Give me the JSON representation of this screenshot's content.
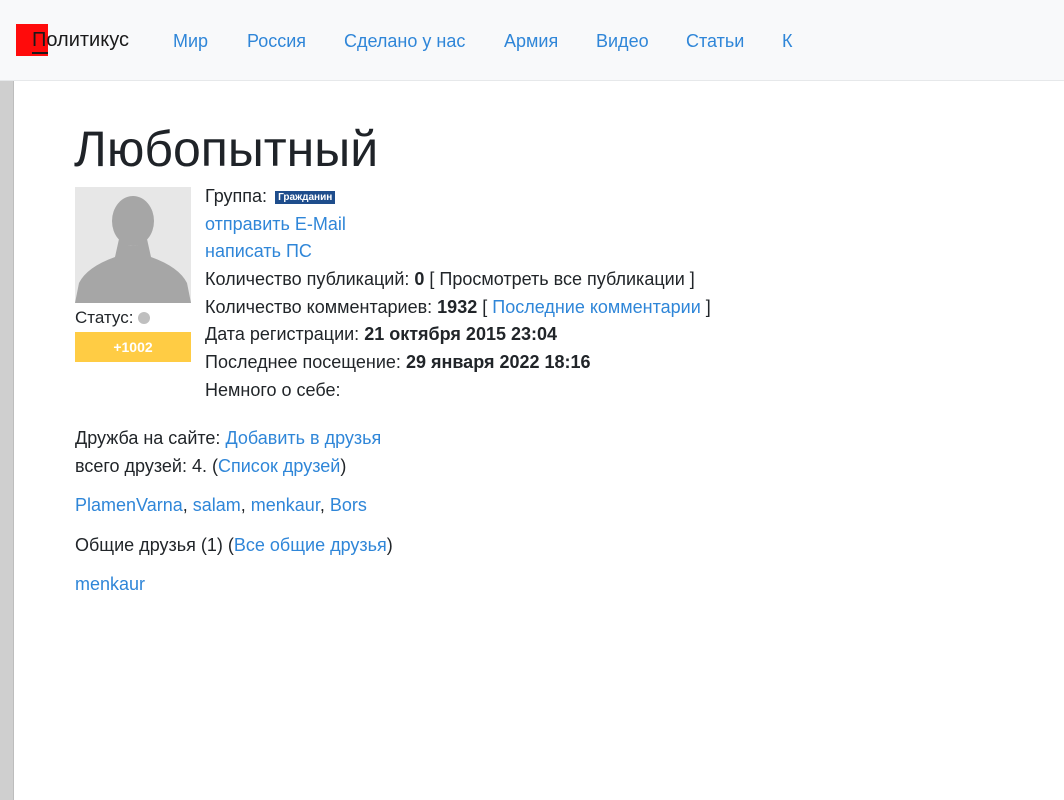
{
  "header": {
    "brand_text": "Политикус",
    "nav": [
      {
        "label": "Мир"
      },
      {
        "label": "Россия"
      },
      {
        "label": "Сделано у нас"
      },
      {
        "label": "Армия"
      },
      {
        "label": "Видео"
      },
      {
        "label": "Статьи"
      },
      {
        "label": "К"
      }
    ]
  },
  "profile": {
    "username": "Любопытный",
    "status_label": "Статус:",
    "rating": "+1002",
    "group_label": "Группа:",
    "group_badge": "Гражданин",
    "send_email": "отправить E-Mail",
    "write_pm": "написать ПС",
    "pubs_label": "Количество публикаций:",
    "pubs_count": "0",
    "pubs_link": "[ Просмотреть все публикации ]",
    "comments_label": "Количество комментариев:",
    "comments_count": "1932",
    "comments_bracket_open": "[",
    "comments_link": "Последние комментарии",
    "comments_bracket_close": "]",
    "reg_label": "Дата регистрации:",
    "reg_date": "21 октября 2015 23:04",
    "last_label": "Последнее посещение:",
    "last_date": "29 января 2022 18:16",
    "about_label": "Немного о себе:"
  },
  "friends": {
    "label": "Дружба на сайте:",
    "add_link": "Добавить в друзья",
    "total_text": "всего друзей: 4. (",
    "list_link": "Список друзей",
    "close_paren": ")",
    "list": [
      "PlamenVarna",
      "salam",
      "menkaur",
      "Bors"
    ],
    "mutual_text": "Общие друзья (1) (",
    "mutual_link": "Все общие друзья",
    "mutual_close": ")",
    "mutual_list": [
      "menkaur"
    ]
  },
  "colors": {
    "link": "#2f86d8",
    "logo": "#ff0b0b",
    "rating_bg": "#ffcc44",
    "badge_bg": "#1e4d8c"
  },
  "icons": {
    "avatar": "default-user-silhouette",
    "status": "offline-dot"
  }
}
